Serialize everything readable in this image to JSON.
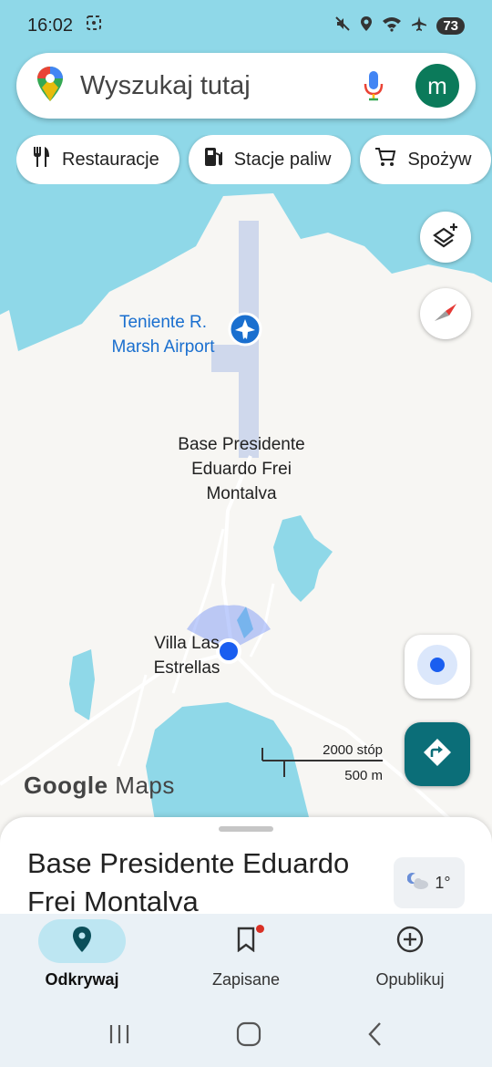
{
  "status_bar": {
    "time": "16:02",
    "battery": "73"
  },
  "search": {
    "placeholder": "Wyszukaj tutaj",
    "avatar_letter": "m"
  },
  "chips": [
    {
      "label": "Restauracje",
      "icon": "fork-knife-icon"
    },
    {
      "label": "Stacje paliw",
      "icon": "gas-station-icon"
    },
    {
      "label": "Spożyw",
      "icon": "cart-icon"
    }
  ],
  "map": {
    "airport_label": "Teniente R. Marsh Airport",
    "base_label": "Base Presidente Eduardo Frei Montalva",
    "villa_label": "Villa Las Estrellas",
    "scale_imperial": "2000 stóp",
    "scale_metric": "500 m",
    "logo_google": "Google",
    "logo_maps": "Maps"
  },
  "sheet": {
    "title": "Base Presidente Eduardo Frei Montalva",
    "weather": "1°"
  },
  "bottom_nav": [
    {
      "label": "Odkrywaj",
      "icon": "location-pin-icon",
      "active": true
    },
    {
      "label": "Zapisane",
      "icon": "bookmark-icon",
      "active": false
    },
    {
      "label": "Opublikuj",
      "icon": "add-circle-icon",
      "active": false
    }
  ],
  "colors": {
    "water": "#8fd8e8",
    "land": "#f7f6f3",
    "accent": "#0b6e78",
    "location_blue": "#1a5ef0",
    "airport_blue": "#1a6fcf"
  }
}
